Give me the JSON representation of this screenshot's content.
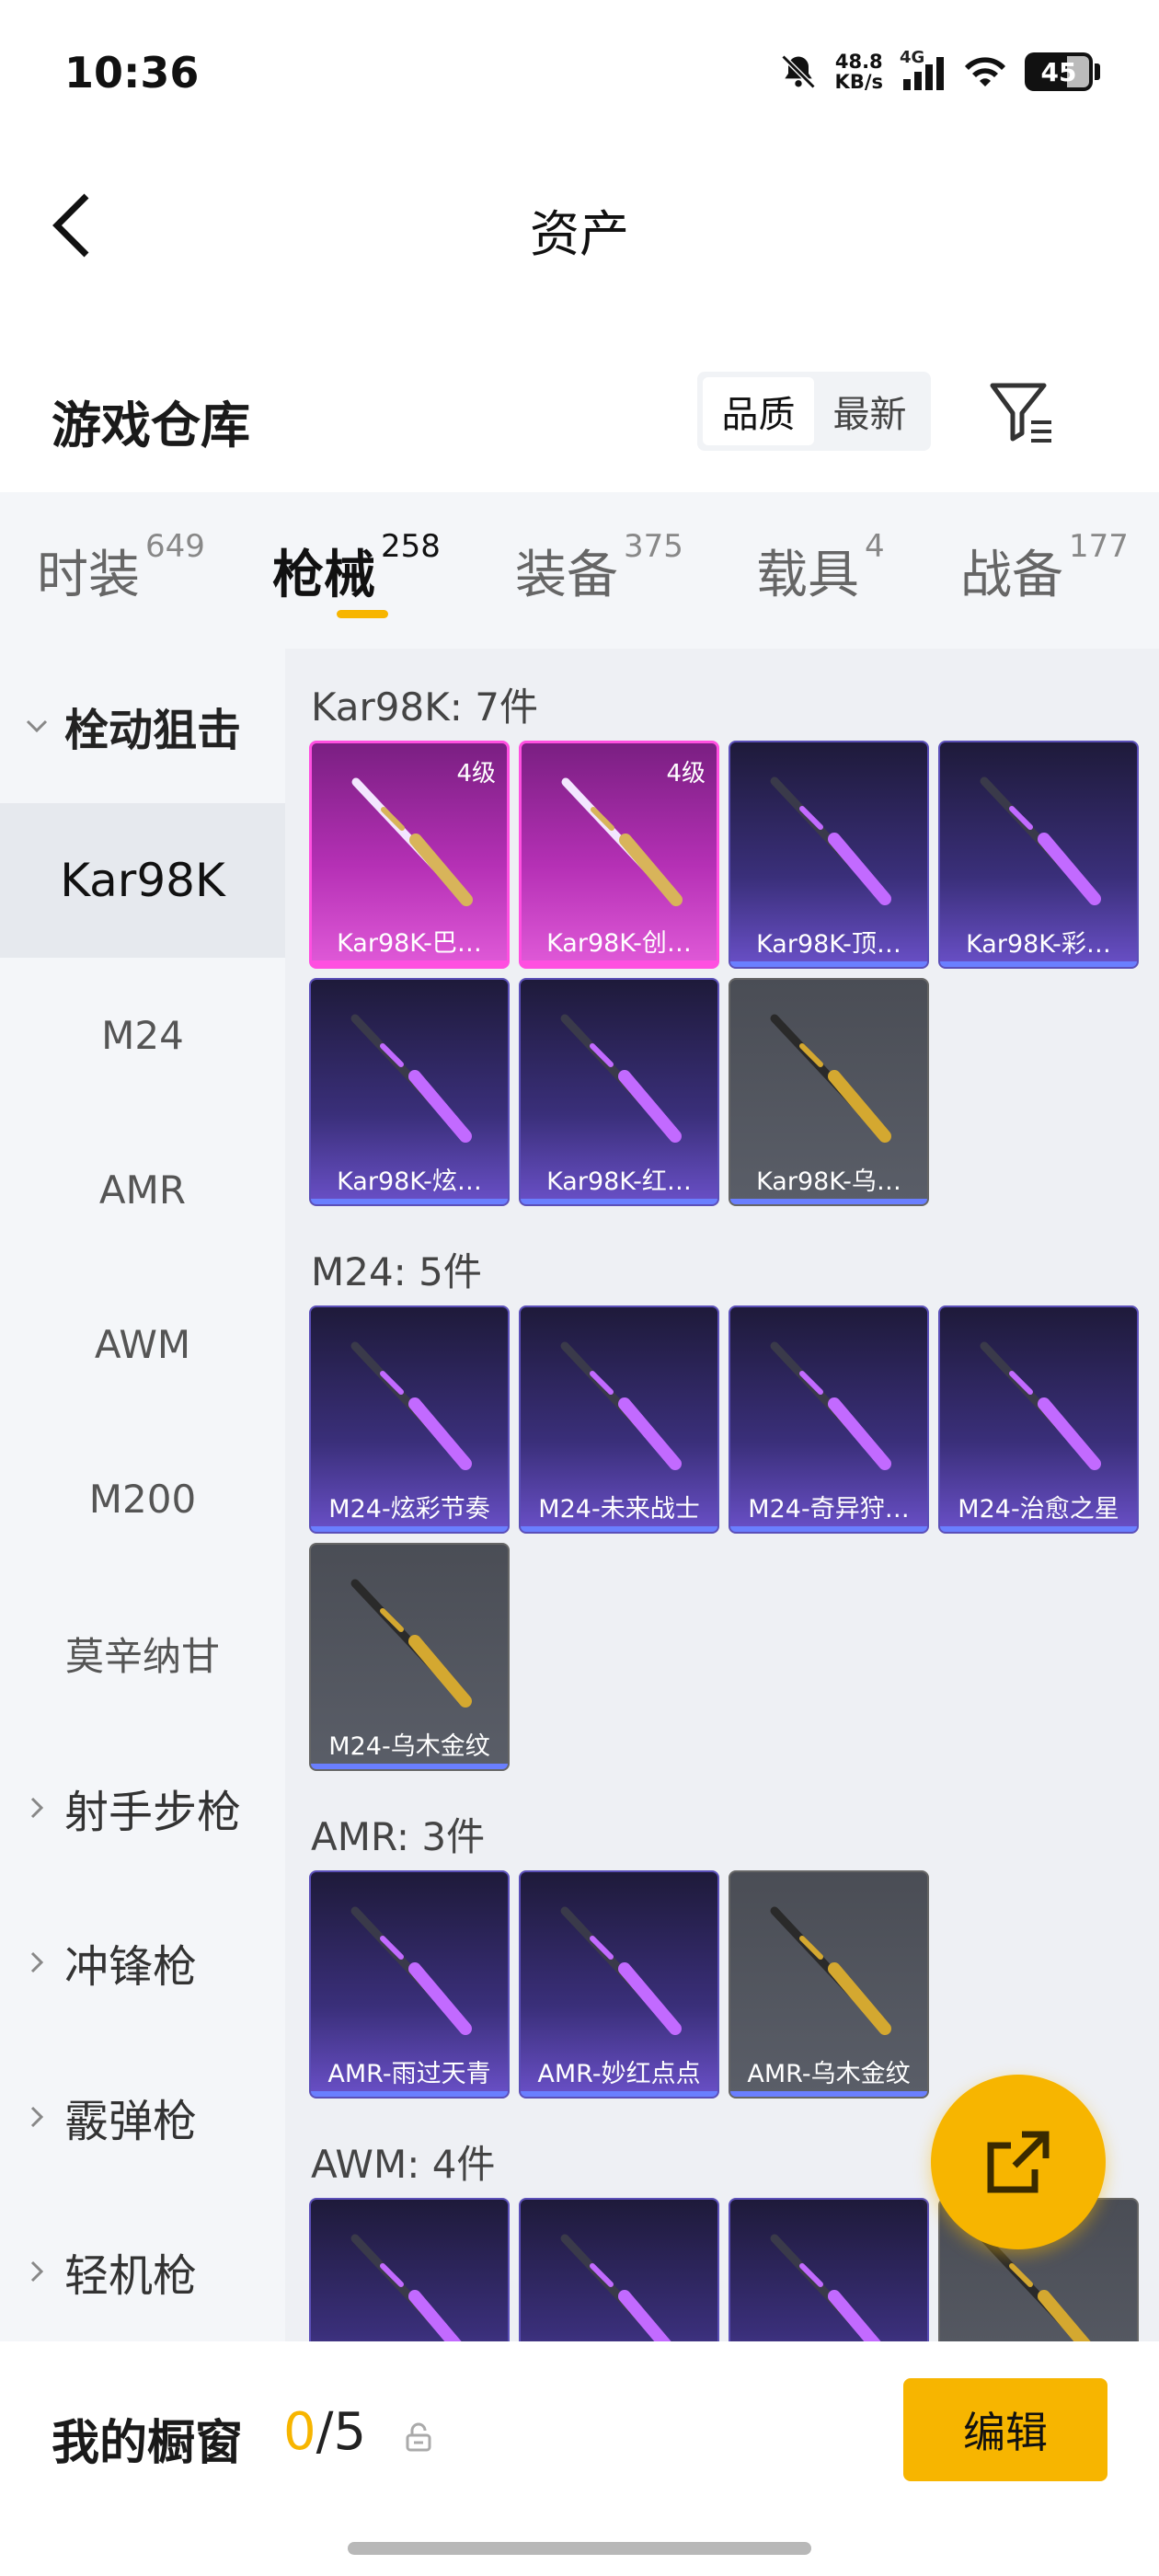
{
  "status": {
    "time": "10:36",
    "net_speed_value": "48.8",
    "net_speed_unit": "KB/s",
    "signal": "4G",
    "battery": "45"
  },
  "header": {
    "title": "资产"
  },
  "warehouse": {
    "title": "游戏仓库",
    "sort_options": [
      "品质",
      "最新"
    ],
    "sort_selected": "品质"
  },
  "tabs": [
    {
      "label": "时装",
      "count": "649"
    },
    {
      "label": "枪械",
      "count": "258",
      "active": true
    },
    {
      "label": "装备",
      "count": "375"
    },
    {
      "label": "载具",
      "count": "4"
    },
    {
      "label": "战备",
      "count": "177"
    }
  ],
  "sidebar": {
    "expanded_group": "栓动狙击",
    "items": [
      "Kar98K",
      "M24",
      "AMR",
      "AWM",
      "M200",
      "莫辛纳甘"
    ],
    "active_item": "Kar98K",
    "collapsed_groups": [
      "射手步枪",
      "冲锋枪",
      "霰弹枪",
      "轻机枪"
    ]
  },
  "groups": [
    {
      "heading": "Kar98K: 7件",
      "items": [
        {
          "name": "Kar98K-巴…",
          "level": "4级",
          "rarity": "pink"
        },
        {
          "name": "Kar98K-创…",
          "level": "4级",
          "rarity": "pink"
        },
        {
          "name": "Kar98K-顶…",
          "rarity": "purple"
        },
        {
          "name": "Kar98K-彩…",
          "rarity": "purple"
        },
        {
          "name": "Kar98K-炫…",
          "rarity": "purple"
        },
        {
          "name": "Kar98K-红…",
          "rarity": "purple"
        },
        {
          "name": "Kar98K-乌…",
          "rarity": "grey"
        }
      ]
    },
    {
      "heading": "M24: 5件",
      "items": [
        {
          "name": "M24-炫彩节奏",
          "rarity": "purple"
        },
        {
          "name": "M24-未来战士",
          "rarity": "purple"
        },
        {
          "name": "M24-奇异狩…",
          "rarity": "purple"
        },
        {
          "name": "M24-治愈之星",
          "rarity": "purple"
        },
        {
          "name": "M24-乌木金纹",
          "rarity": "grey"
        }
      ]
    },
    {
      "heading": "AMR: 3件",
      "items": [
        {
          "name": "AMR-雨过天青",
          "rarity": "purple"
        },
        {
          "name": "AMR-妙红点点",
          "rarity": "purple"
        },
        {
          "name": "AMR-乌木金纹",
          "rarity": "grey"
        }
      ]
    },
    {
      "heading": "AWM: 4件",
      "items": [
        {
          "name": "",
          "rarity": "purple"
        },
        {
          "name": "",
          "rarity": "purple"
        },
        {
          "name": "",
          "rarity": "purple"
        },
        {
          "name": "",
          "rarity": "grey"
        }
      ]
    }
  ],
  "bottom": {
    "showcase_label": "我的橱窗",
    "showcase_current": "0",
    "showcase_total": "/5",
    "edit_label": "编辑"
  },
  "colors": {
    "accent": "#f7b500",
    "purple_rarity": "#5b4fb8",
    "pink_rarity": "#ff4fe0",
    "grey_rarity": "#5a5e68"
  }
}
